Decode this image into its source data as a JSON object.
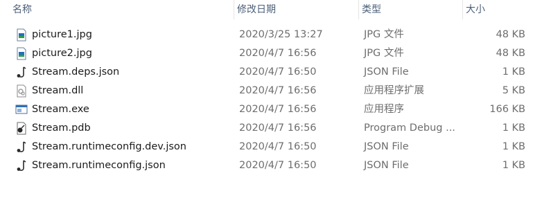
{
  "columns": {
    "name": "名称",
    "modified": "修改日期",
    "type": "类型",
    "size": "大小",
    "sort_indicator": "^"
  },
  "files": [
    {
      "name": "picture1.jpg",
      "modified": "2020/3/25 13:27",
      "type": "JPG 文件",
      "size": "48 KB",
      "icon": "jpg-image-icon"
    },
    {
      "name": "picture2.jpg",
      "modified": "2020/4/7 16:56",
      "type": "JPG 文件",
      "size": "48 KB",
      "icon": "jpg-image-icon"
    },
    {
      "name": "Stream.deps.json",
      "modified": "2020/4/7 16:50",
      "type": "JSON File",
      "size": "1 KB",
      "icon": "json-file-icon"
    },
    {
      "name": "Stream.dll",
      "modified": "2020/4/7 16:56",
      "type": "应用程序扩展",
      "size": "5 KB",
      "icon": "dll-file-icon"
    },
    {
      "name": "Stream.exe",
      "modified": "2020/4/7 16:56",
      "type": "应用程序",
      "size": "166 KB",
      "icon": "exe-file-icon"
    },
    {
      "name": "Stream.pdb",
      "modified": "2020/4/7 16:56",
      "type": "Program Debug ...",
      "size": "1 KB",
      "icon": "pdb-file-icon"
    },
    {
      "name": "Stream.runtimeconfig.dev.json",
      "modified": "2020/4/7 16:50",
      "type": "JSON File",
      "size": "1 KB",
      "icon": "json-file-icon"
    },
    {
      "name": "Stream.runtimeconfig.json",
      "modified": "2020/4/7 16:50",
      "type": "JSON File",
      "size": "1 KB",
      "icon": "json-file-icon"
    }
  ]
}
